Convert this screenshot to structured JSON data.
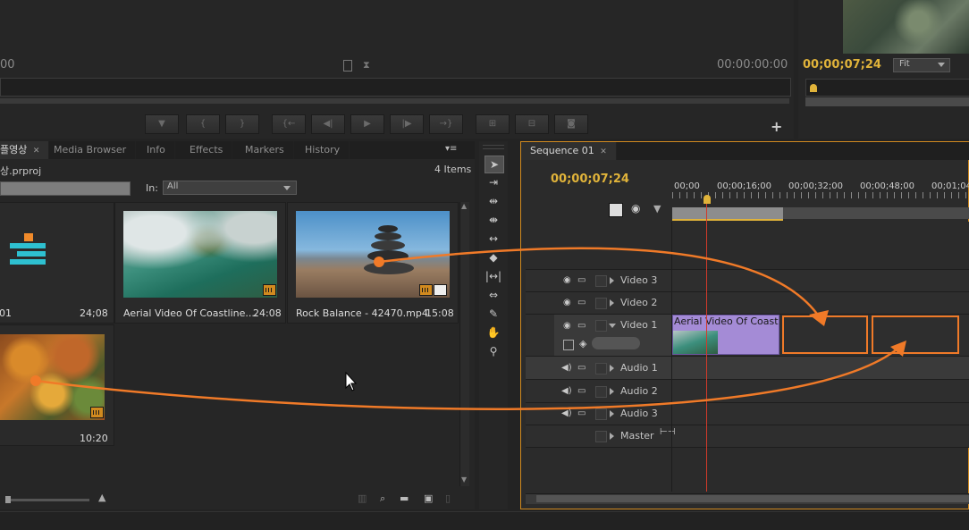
{
  "source_monitor": {
    "timecode_left": "00",
    "timecode_right": "00:00:00:00"
  },
  "program_monitor": {
    "timecode": "00;00;07;24",
    "fit_label": "Fit"
  },
  "project_panel": {
    "tabs": [
      "플영상",
      "Media Browser",
      "Info",
      "Effects",
      "Markers",
      "History"
    ],
    "project_name": "상.prproj",
    "item_count": "4 Items",
    "in_label": "In:",
    "in_value": "All",
    "items": [
      {
        "name": "01",
        "duration": "24;08"
      },
      {
        "name": "Aerial Video Of Coastline....",
        "duration": "24:08"
      },
      {
        "name": "Rock Balance - 42470.mp4",
        "duration": "15:08"
      },
      {
        "name": "",
        "duration": "10:20"
      }
    ]
  },
  "sequence_panel": {
    "tab_label": "Sequence 01",
    "timecode": "00;00;07;24",
    "ruler_ticks": [
      "00;00",
      "00;00;16;00",
      "00;00;32;00",
      "00;00;48;00",
      "00;01;04"
    ],
    "tracks": [
      {
        "name": "Video 3"
      },
      {
        "name": "Video 2"
      },
      {
        "name": "Video 1"
      },
      {
        "name": "Audio 1"
      },
      {
        "name": "Audio 2"
      },
      {
        "name": "Audio 3"
      },
      {
        "name": "Master"
      }
    ],
    "clip_label": "Aerial Video Of Coastli"
  },
  "colors": {
    "accent_orange": "#f07a28",
    "timecode_yellow": "#e0b33a",
    "clip_purple": "#a48bd6",
    "playhead_red": "#d23a2a"
  }
}
